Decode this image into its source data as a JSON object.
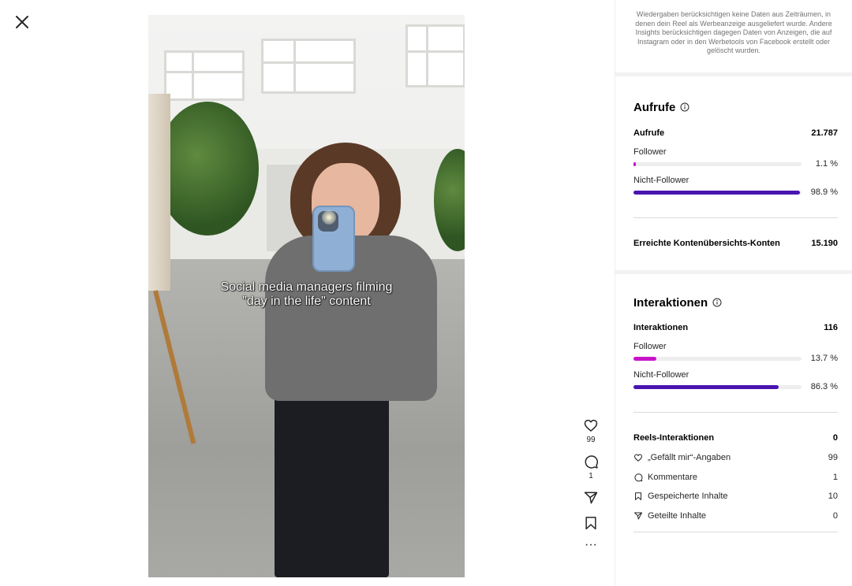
{
  "viewer": {
    "close_label": "Schließen",
    "caption_line1": "Social media managers filming",
    "caption_line2": "\"day in the life\" content"
  },
  "actions": {
    "likes": "99",
    "comments": "1",
    "more": "···"
  },
  "panel": {
    "note": "Wiedergaben berücksichtigen keine Daten aus Zeiträumen, in denen dein Reel als Werbeanzeige ausgeliefert wurde. Andere Insights berücksichtigen dagegen Daten von Anzeigen, die auf Instagram oder in den Werbetools von Facebook erstellt oder gelöscht wurden.",
    "views": {
      "title": "Aufrufe",
      "total_label": "Aufrufe",
      "total_value": "21.787",
      "follower_label": "Follower",
      "follower_value": "1.1 %",
      "follower_pct": 1.1,
      "nonfollower_label": "Nicht-Follower",
      "nonfollower_value": "98.9 %",
      "nonfollower_pct": 98.9,
      "reach_label": "Erreichte Kontenübersichts-Konten",
      "reach_value": "15.190"
    },
    "interactions": {
      "title": "Interaktionen",
      "total_label": "Interaktionen",
      "total_value": "116",
      "follower_label": "Follower",
      "follower_value": "13.7 %",
      "follower_pct": 13.7,
      "nonfollower_label": "Nicht-Follower",
      "nonfollower_value": "86.3 %",
      "nonfollower_pct": 86.3,
      "reels_label": "Reels-Interaktionen",
      "reels_value": "0",
      "likes_label": "„Gefällt mir“-Angaben",
      "likes_value": "99",
      "comments_label": "Kommentare",
      "comments_value": "1",
      "saved_label": "Gespeicherte Inhalte",
      "saved_value": "10",
      "shared_label": "Geteilte Inhalte",
      "shared_value": "0"
    }
  },
  "colors": {
    "follower_bar": "#c913c9",
    "nonfollower_bar": "#4a14b0",
    "track": "#eeeeee"
  },
  "icons": [
    "close-icon",
    "heart-icon",
    "comment-icon",
    "share-icon",
    "bookmark-icon",
    "more-icon",
    "info-icon"
  ]
}
